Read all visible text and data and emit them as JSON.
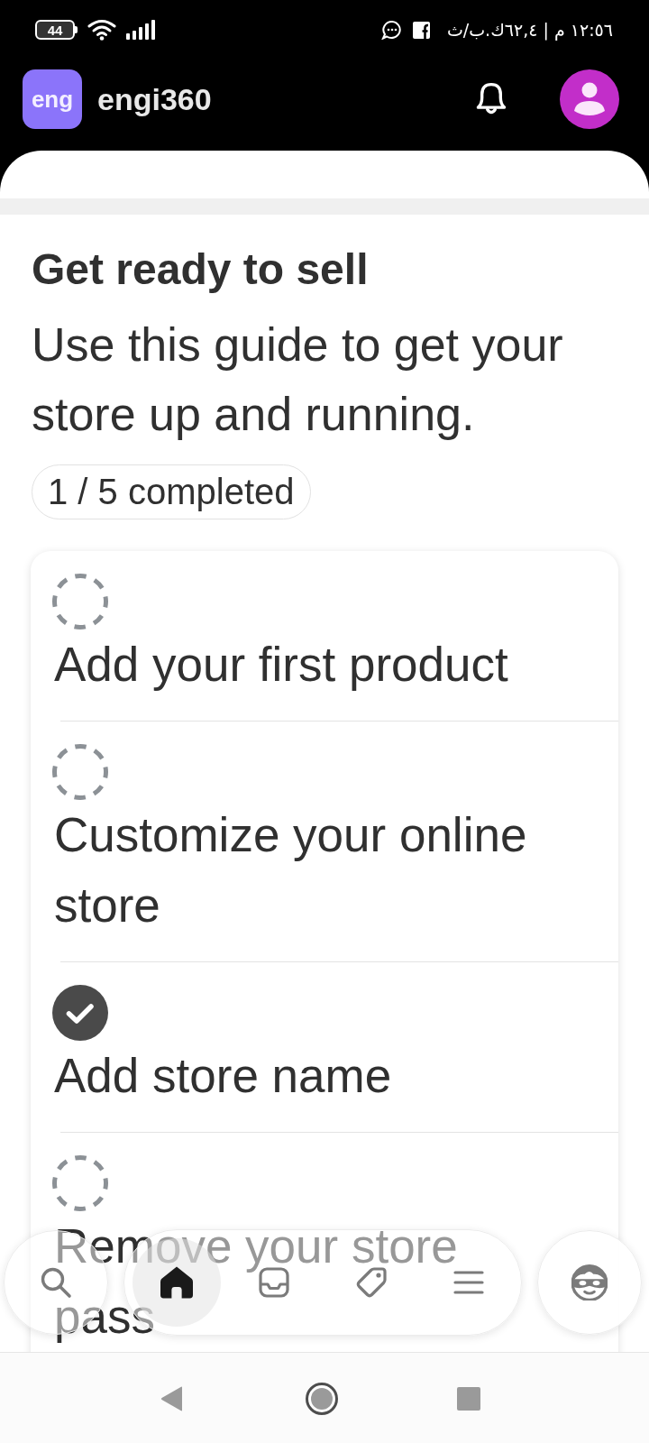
{
  "status_bar": {
    "battery": "44",
    "clock_and_speed": "١٢:٥٦ م | ٦٢,٤ك.ب/ث"
  },
  "header": {
    "logo": "eng",
    "title": "engi360"
  },
  "setup_guide": {
    "title": "Get ready to sell",
    "description": "Use this guide to get your store up and running.",
    "progress": "1 / 5 completed",
    "tasks": [
      {
        "label": "Add your first product",
        "done": false
      },
      {
        "label": "Customize your online store",
        "done": false
      },
      {
        "label": "Add store name",
        "done": true
      },
      {
        "label": "Remove your store pass",
        "done": false
      }
    ]
  },
  "bottom_nav": {
    "items": [
      {
        "kind": "home",
        "selected": true
      },
      {
        "kind": "inbox",
        "selected": false
      },
      {
        "kind": "tag",
        "selected": false
      },
      {
        "kind": "menu",
        "selected": false
      }
    ]
  }
}
